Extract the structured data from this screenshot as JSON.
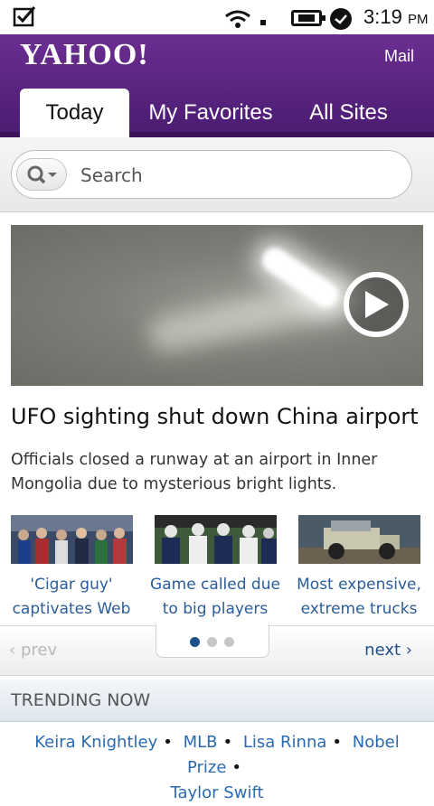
{
  "status_bar": {
    "time": "3:19",
    "ampm": "PM",
    "icons": [
      "notification-check-icon",
      "wifi-icon",
      "battery-icon",
      "clock-icon"
    ]
  },
  "header": {
    "logo": "YAHOO!",
    "mail_link": "Mail",
    "tabs": [
      {
        "label": "Today",
        "active": true
      },
      {
        "label": "My Favorites",
        "active": false
      },
      {
        "label": "All Sites",
        "active": false
      }
    ],
    "brand_color": "#5a2480"
  },
  "search": {
    "placeholder": "Search",
    "icon": "search-icon"
  },
  "featured": {
    "headline": "UFO sighting shut down China airport",
    "summary": "Officials closed a runway at an airport in Inner Mongolia due to mysterious bright lights."
  },
  "stories": [
    {
      "caption": "'Cigar guy' captivates Web"
    },
    {
      "caption": "Game called due to big players"
    },
    {
      "caption": "Most expensive, extreme trucks"
    }
  ],
  "pager": {
    "prev_label": "prev",
    "next_label": "next",
    "page_count": 3,
    "current_page": 1
  },
  "trending": {
    "title": "TRENDING NOW",
    "items": [
      "Keira Knightley",
      "MLB",
      "Lisa Rinna",
      "Nobel Prize",
      "Taylor Swift"
    ]
  }
}
